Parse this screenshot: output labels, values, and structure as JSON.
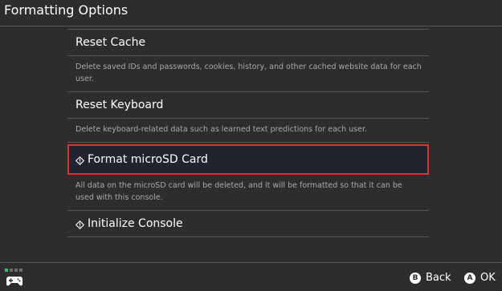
{
  "header": {
    "title": "Formatting Options"
  },
  "items": [
    {
      "title": "Reset Cache",
      "description": "Delete saved IDs and passwords, cookies, history, and other cached website data for each user."
    },
    {
      "title": "Reset Keyboard",
      "description": "Delete keyboard-related data such as learned text predictions for each user."
    },
    {
      "title": "Format microSD Card",
      "description": "All data on the microSD card will be deleted, and it will be formatted so that it can be used with this console."
    },
    {
      "title": "Initialize Console",
      "description": ""
    }
  ],
  "footer": {
    "back": {
      "button": "B",
      "label": "Back"
    },
    "ok": {
      "button": "A",
      "label": "OK"
    }
  },
  "colors": {
    "accent": "#e0312e",
    "indicator": "#35c95a",
    "background": "#2d2d2d"
  }
}
